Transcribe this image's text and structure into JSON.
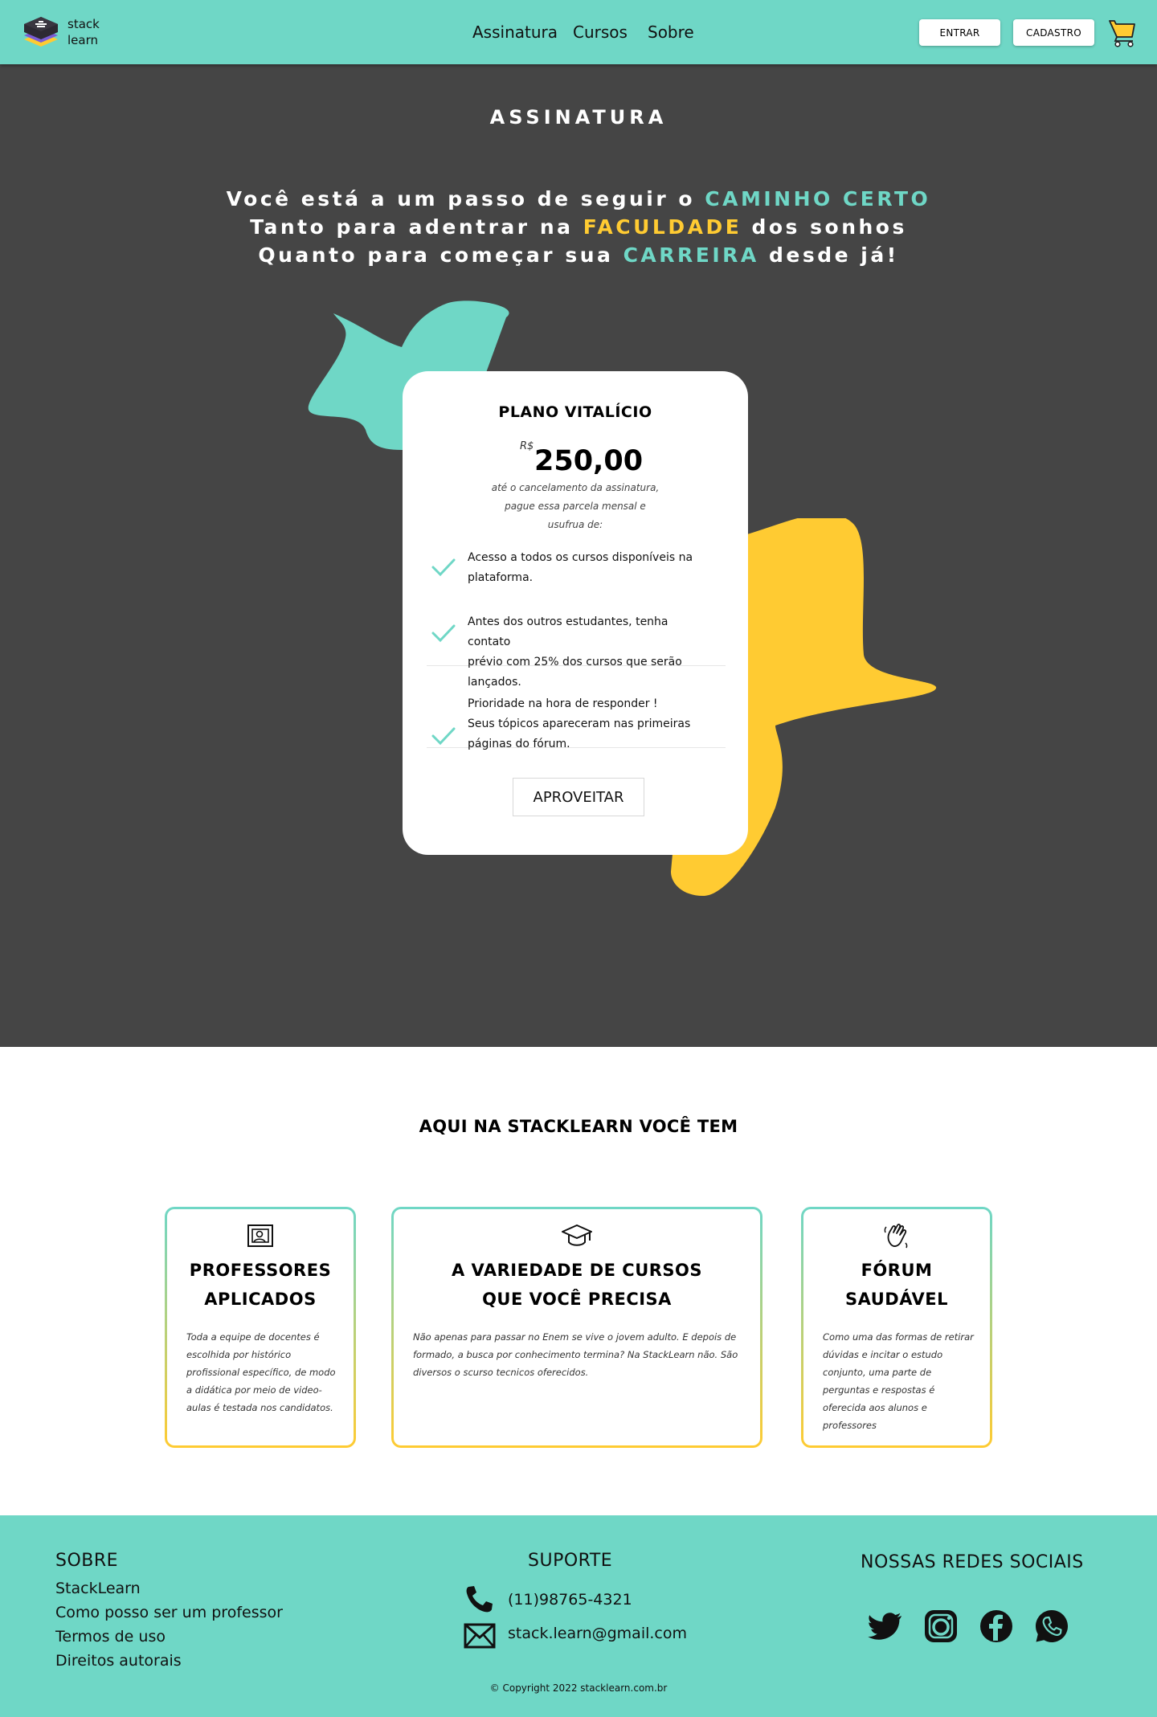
{
  "header": {
    "logo_text_line1": "stack",
    "logo_text_line2": "learn",
    "nav": [
      "Assinatura",
      "Cursos",
      "Sobre"
    ],
    "login_label": "ENTRAR",
    "signup_label": "CADASTRO",
    "cart_icon": "cart-icon"
  },
  "hero": {
    "title": "ASSINATURA",
    "line1_prefix": "Você está a um passo de seguir o ",
    "line1_highlight": "CAMINHO CERTO",
    "line2_prefix": "Tanto para adentrar na ",
    "line2_highlight": "FACULDADE",
    "line2_suffix": " dos sonhos",
    "line3_prefix": "Quanto para começar sua ",
    "line3_highlight": "CARREIRA",
    "line3_suffix": " desde já!"
  },
  "plan": {
    "title": "PLANO VITALÍCIO",
    "currency": "R$",
    "price": "250,00",
    "note_line1": "até o cancelamento da assinatura,",
    "note_line2": "pague essa parcela mensal e",
    "note_line3": "usufrua de:",
    "benefits": [
      {
        "line1": "Acesso a todos os cursos disponíveis na",
        "line2": "plataforma.",
        "line3": ""
      },
      {
        "line1": "Antes dos outros estudantes,  tenha contato",
        "line2": "prévio com 25% dos cursos que serão",
        "line3": "lançados."
      },
      {
        "line1": "Prioridade na hora de responder !",
        "line2": "Seus tópicos apareceram nas primeiras",
        "line3": "páginas do fórum."
      }
    ],
    "cta_label": "APROVEITAR"
  },
  "features": {
    "title": "AQUI NA STACKLEARN VOCÊ TEM",
    "cards": [
      {
        "icon": "presentation-icon",
        "title_line1": "PROFESSORES",
        "title_line2": "APLICADOS",
        "desc": "Toda a equipe de docentes é escolhida por histórico profissional específico, de modo a didática por meio de video-aulas é testada nos candidatos."
      },
      {
        "icon": "graduation-cap-icon",
        "title_line1": "A VARIEDADE DE CURSOS",
        "title_line2": "QUE VOCÊ PRECISA",
        "desc": "Não apenas para passar no Enem se vive o jovem adulto. E depois de formado, a busca por conhecimento termina? Na StackLearn não. São diversos o scurso tecnicos oferecidos."
      },
      {
        "icon": "waving-hand-icon",
        "title_line1": "FÓRUM",
        "title_line2": "SAUDÁVEL",
        "desc": "Como uma das formas de retirar dúvidas e incitar o estudo conjunto, uma parte de perguntas e respostas é oferecida aos alunos e professores"
      }
    ]
  },
  "footer": {
    "about_title": "SOBRE",
    "about_links": [
      "StackLearn",
      "Como posso ser um professor",
      "Termos de uso",
      "Direitos autorais"
    ],
    "support_title": "SUPORTE",
    "phone": "(11)98765-4321",
    "email": "stack.learn@gmail.com",
    "social_title": "NOSSAS REDES SOCIAIS",
    "social_icons": [
      "twitter-icon",
      "instagram-icon",
      "facebook-icon",
      "whatsapp-icon"
    ],
    "copyright": "© Copyright 2022 stacklearn.com.br"
  },
  "colors": {
    "teal": "#6fd7c6",
    "yellow": "#ffcb32",
    "dark": "#454545"
  }
}
